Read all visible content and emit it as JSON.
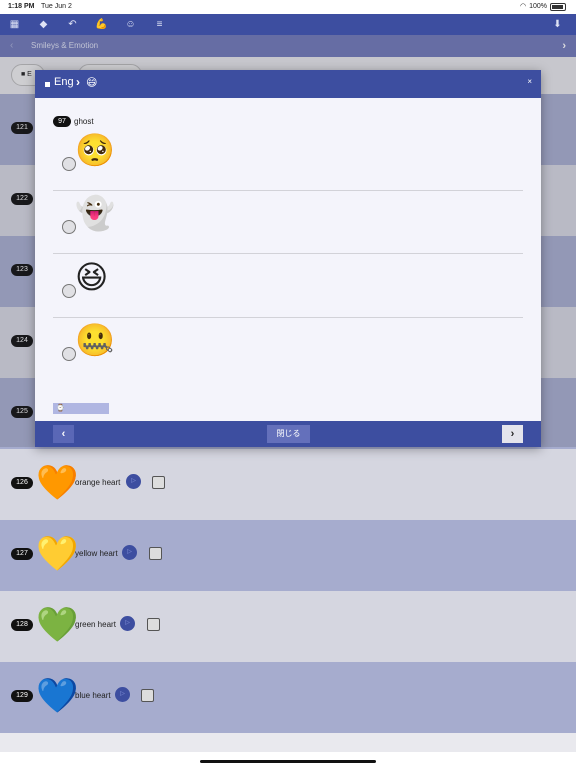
{
  "status_bar": {
    "time": "1:18 PM",
    "date": "Tue Jun 2",
    "battery": "100%"
  },
  "toolbar": {
    "icons": [
      "grid-icon",
      "tag-icon",
      "undo-icon",
      "muscle-icon",
      "smiley-icon",
      "list-icon",
      "download-icon"
    ],
    "glyphs": {
      "grid": "▦",
      "tag": "◆",
      "undo": "↶",
      "muscle": "💪",
      "smiley": "☺",
      "list": "≡",
      "download": "⬇"
    }
  },
  "category_bar": {
    "prev": "‹",
    "title": "Smileys & Emotion",
    "next": "›"
  },
  "filter": {
    "chip_label": "■ E"
  },
  "list": {
    "rows": [
      {
        "num": "121",
        "emoji": "",
        "label": ""
      },
      {
        "num": "122",
        "emoji": "",
        "label": ""
      },
      {
        "num": "123",
        "emoji": "",
        "label": ""
      },
      {
        "num": "124",
        "emoji": "",
        "label": ""
      },
      {
        "num": "125",
        "emoji": "",
        "label": ""
      },
      {
        "num": "126",
        "emoji": "🧡",
        "label": "orange heart"
      },
      {
        "num": "127",
        "emoji": "💛",
        "label": "yellow heart"
      },
      {
        "num": "128",
        "emoji": "💚",
        "label": "green heart"
      },
      {
        "num": "129",
        "emoji": "💙",
        "label": "blue heart"
      }
    ],
    "play_glyph": "▷"
  },
  "modal": {
    "header": {
      "square": "■",
      "lang": "Eng",
      "chevron": "›",
      "face": "😄",
      "close": "×"
    },
    "question": {
      "num": "97",
      "word": "ghost"
    },
    "options": [
      {
        "emoji": "🥺"
      },
      {
        "emoji": "👻"
      },
      {
        "emoji": "😆"
      },
      {
        "emoji": "🤐"
      }
    ],
    "answer_icon": "⌚",
    "footer": {
      "back": "‹",
      "close": "閉じる",
      "forward": "›"
    }
  }
}
